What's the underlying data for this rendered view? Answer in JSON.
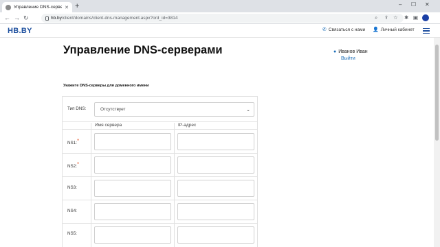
{
  "browser": {
    "tab_title": "Управление DNS-серверами",
    "url_host": "hb.by",
    "url_path": "/client/domains/client-dns-management.aspx?ord_id=3814"
  },
  "header": {
    "logo": "HB.BY",
    "contact_label": "Связаться с нами",
    "cabinet_label": "Личный кабинет"
  },
  "user": {
    "name": "Иванов Иван",
    "logout": "Выйти"
  },
  "page": {
    "title": "Управление DNS-серверами",
    "subtitle": "Укажите DNS-серверы для доменного имени"
  },
  "form": {
    "dns_type_label": "Тип DNS:",
    "dns_type_value": "Отсутствует",
    "col_server": "Имя сервера",
    "col_ip": "IP-адрес",
    "rows": [
      {
        "label": "NS1:",
        "required": "*"
      },
      {
        "label": "NS2:",
        "required": "*"
      },
      {
        "label": "NS3:",
        "required": ""
      },
      {
        "label": "NS4:",
        "required": ""
      },
      {
        "label": "NS5:",
        "required": ""
      }
    ]
  },
  "colors": {
    "brand": "#1d4f9e",
    "link": "#1d6fb8",
    "required": "#e8643c"
  }
}
